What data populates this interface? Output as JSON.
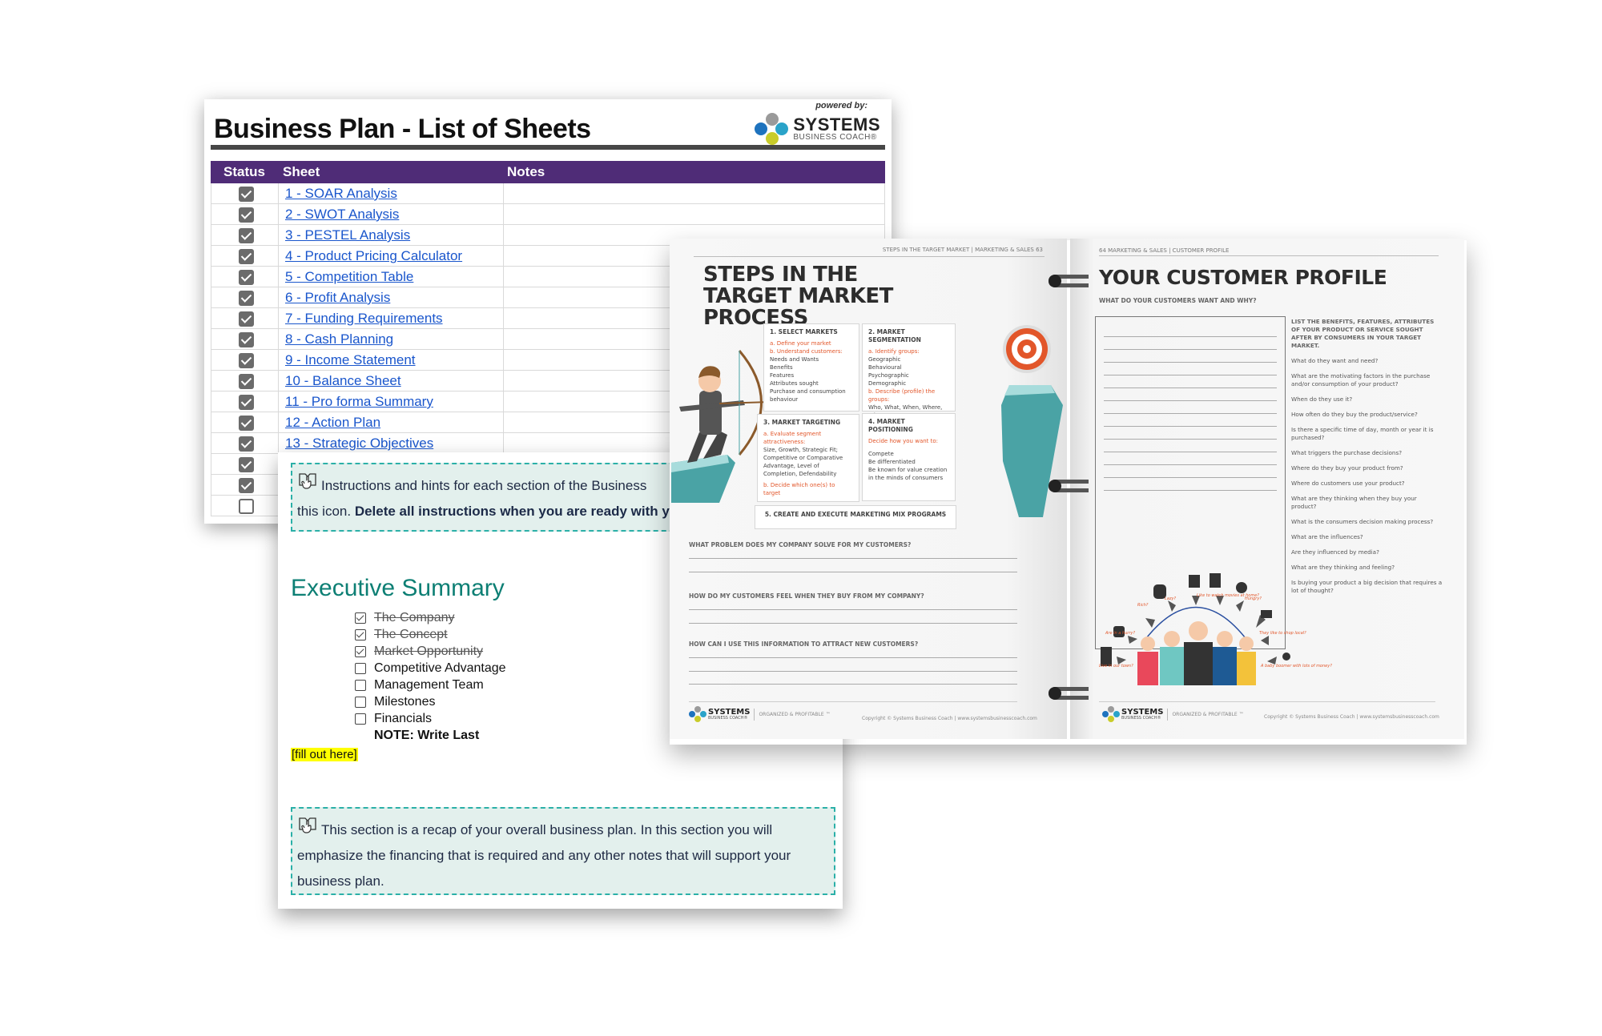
{
  "spreadsheet": {
    "title": "Business Plan - List of Sheets",
    "logo": {
      "powered_by": "powered by:",
      "name": "SYSTEMS",
      "subname": "BUSINESS COACH®"
    },
    "columns": [
      "Status",
      "Sheet",
      "Notes"
    ],
    "rows": [
      {
        "checked": true,
        "sheet": "1 - SOAR Analysis",
        "notes": ""
      },
      {
        "checked": true,
        "sheet": "2 - SWOT Analysis",
        "notes": ""
      },
      {
        "checked": true,
        "sheet": "3 - PESTEL Analysis",
        "notes": ""
      },
      {
        "checked": true,
        "sheet": "4 - Product Pricing Calculator",
        "notes": ""
      },
      {
        "checked": true,
        "sheet": "5 - Competition Table",
        "notes": ""
      },
      {
        "checked": true,
        "sheet": "6 - Profit Analysis",
        "notes": ""
      },
      {
        "checked": true,
        "sheet": "7 - Funding Requirements",
        "notes": ""
      },
      {
        "checked": true,
        "sheet": "8 - Cash Planning",
        "notes": ""
      },
      {
        "checked": true,
        "sheet": "9 - Income Statement",
        "notes": ""
      },
      {
        "checked": true,
        "sheet": "10 - Balance Sheet",
        "notes": ""
      },
      {
        "checked": true,
        "sheet": "11 - Pro forma Summary",
        "notes": ""
      },
      {
        "checked": true,
        "sheet": "12 - Action Plan",
        "notes": ""
      },
      {
        "checked": true,
        "sheet": "13 - Strategic Objectives",
        "notes": ""
      },
      {
        "checked": true,
        "sheet": "",
        "notes": ""
      },
      {
        "checked": true,
        "sheet": "",
        "notes": ""
      },
      {
        "checked": false,
        "sheet": "",
        "notes": ""
      }
    ]
  },
  "document": {
    "hint_top": {
      "text": "Instructions and hints for each section of the Business",
      "line2_plain": "this icon. ",
      "line2_bold": "Delete all instructions when you are ready with yo"
    },
    "section_title": "Executive Summary",
    "checklist": [
      {
        "label": "The Company",
        "checked": true
      },
      {
        "label": "The Concept",
        "checked": true
      },
      {
        "label": "Market Opportunity",
        "checked": true
      },
      {
        "label": "Competitive Advantage",
        "checked": false
      },
      {
        "label": "Management Team",
        "checked": false
      },
      {
        "label": "Milestones",
        "checked": false
      },
      {
        "label": "Financials",
        "checked": false
      }
    ],
    "note": "NOTE: Write Last",
    "fill_placeholder": "[fill out here]",
    "hint_bottom": {
      "line1": "This section is a recap of your overall business plan. In this section you will",
      "line2": "emphasize the financing that is required and any other notes that will support your",
      "line3": "business plan."
    }
  },
  "binder": {
    "left_page": {
      "running_head": "STEPS IN THE TARGET MARKET   |   MARKETING & SALES  63",
      "title_lines": [
        "STEPS IN THE",
        "TARGET MARKET",
        "PROCESS"
      ],
      "boxes": [
        {
          "heading": "1. SELECT MARKETS",
          "orange": [
            "a. Define your market",
            "b. Understand customers:"
          ],
          "items": [
            "Needs and Wants",
            "Benefits",
            "Features",
            "Attributes sought",
            "Purchase and consumption behaviour"
          ]
        },
        {
          "heading": "2. MARKET SEGMENTATION",
          "orange": [
            "a. Identify groups:"
          ],
          "items": [
            "Geographic",
            "Behavioural",
            "Psychographic",
            "Demographic"
          ],
          "orange2": "b. Describe (profile) the groups:",
          "tail": "Who, What, When, Where, Why"
        },
        {
          "heading": "3. MARKET TARGETING",
          "orange": [
            "a. Evaluate segment attractiveness:"
          ],
          "items": [
            "Size, Growth, Strategic Fit; Competitive or Comparative Advantage, Level of Completion, Defendability"
          ],
          "orange2": "b. Decide which one(s) to target"
        },
        {
          "heading": "4. MARKET POSITIONING",
          "orange": [
            "Decide how you want to:"
          ],
          "items": [
            "Compete",
            "Be differentiated",
            "Be known for value creation in the minds of consumers"
          ]
        }
      ],
      "box5": "5. CREATE AND EXECUTE MARKETING MIX PROGRAMS",
      "questions": [
        "WHAT PROBLEM DOES MY COMPANY SOLVE FOR MY CUSTOMERS?",
        "HOW DO MY CUSTOMERS FEEL WHEN THEY BUY FROM MY COMPANY?",
        "HOW CAN I USE THIS INFORMATION TO ATTRACT NEW CUSTOMERS?"
      ],
      "footer": {
        "brand": "SYSTEMS",
        "sub": "BUSINESS COACH®",
        "tagline": "ORGANIZED & PROFITABLE ™",
        "copyright": "Copyright © Systems Business Coach  |  www.systemsbusinesscoach.com"
      }
    },
    "right_page": {
      "running_head": "64  MARKETING & SALES  |   CUSTOMER PROFILE",
      "title": "YOUR CUSTOMER PROFILE",
      "subtitle": "WHAT DO YOUR CUSTOMERS WANT AND WHY?",
      "list_heading": "LIST THE BENEFITS, FEATURES, ATTRIBUTES OF YOUR PRODUCT OR SERVICE SOUGHT AFTER BY CONSUMERS IN YOUR TARGET MARKET.",
      "questions": [
        "What do they want and need?",
        "What are the motivating factors in the purchase and/or consumption of your product?",
        "When do they use it?",
        "How often do they buy the product/service?",
        "Is there a specific time of day, month or year it is purchased?",
        "What triggers the purchase decisions?",
        "Where do they buy your product from?",
        "Where do customers use your product?",
        "What are they thinking when they buy your product?",
        "What is the consumers decision making process?",
        "What are the influences?",
        "Are they influenced by media?",
        "What are they thinking and feeling?",
        "Is buying your product a big decision that requires a lot of thought?"
      ],
      "persona_labels": [
        "Rich?",
        "Lazy?",
        "Like to watch movies at home?",
        "Hungry?",
        "Are in a hurry?",
        "They like to shop local?",
        "Live in our town?",
        "A baby boomer with lots of money?"
      ],
      "footer": {
        "brand": "SYSTEMS",
        "sub": "BUSINESS COACH®",
        "tagline": "ORGANIZED & PROFITABLE ™",
        "copyright": "Copyright © Systems Business Coach  |  www.systemsbusinesscoach.com"
      }
    }
  },
  "colors": {
    "header_purple": "#4f2c77",
    "link_blue": "#1a56cc",
    "teal_title": "#0d7f74",
    "hint_border": "#2bb0a8",
    "hint_bg": "#e3f0ed",
    "orange_accent": "#e2562a",
    "highlight_yellow": "#ffff00"
  }
}
